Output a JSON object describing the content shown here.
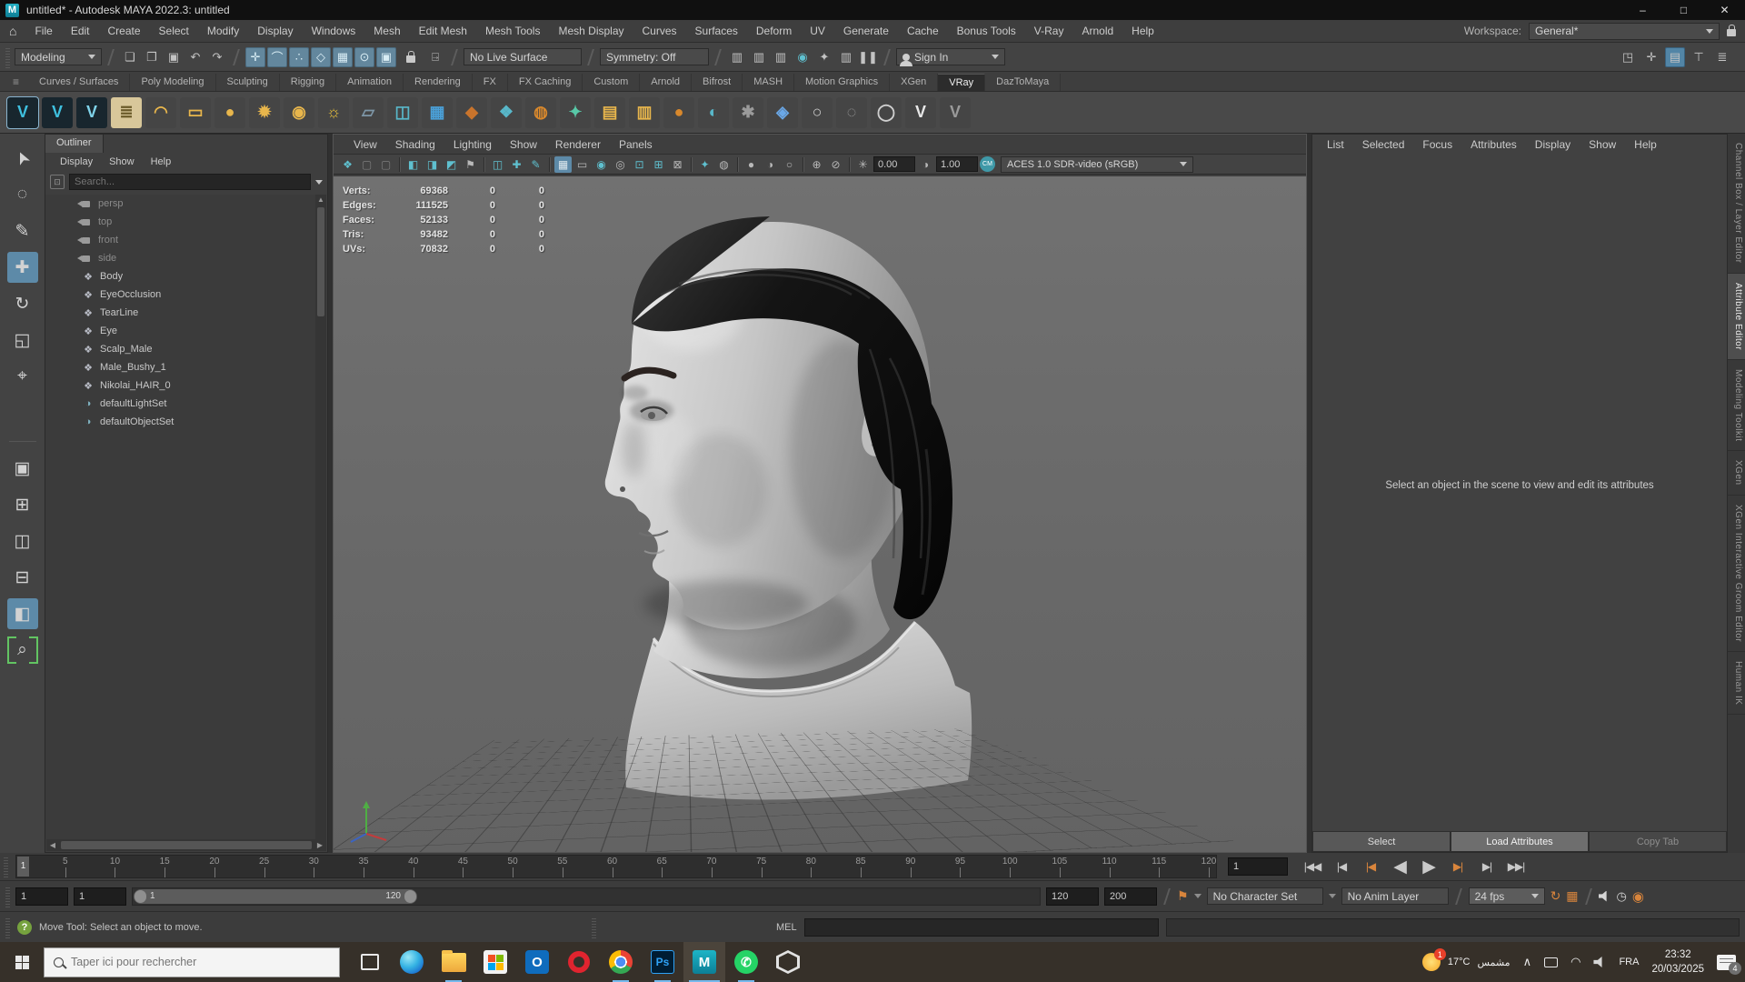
{
  "title_bar": {
    "title": "untitled* - Autodesk MAYA 2022.3: untitled",
    "minimize": "–",
    "maximize": "□",
    "close": "✕"
  },
  "menu_bar": {
    "home_icon": "⌂",
    "items": [
      "File",
      "Edit",
      "Create",
      "Select",
      "Modify",
      "Display",
      "Windows",
      "Mesh",
      "Edit Mesh",
      "Mesh Tools",
      "Mesh Display",
      "Curves",
      "Surfaces",
      "Deform",
      "UV",
      "Generate",
      "Cache",
      "Bonus Tools",
      "V-Ray",
      "Arnold",
      "Help"
    ],
    "workspace_label": "Workspace:",
    "workspace_value": "General*"
  },
  "status_line": {
    "mode": "Modeling",
    "live_surface": "No Live Surface",
    "symmetry": "Symmetry: Off",
    "sign_in": "Sign In",
    "file_icons": [
      {
        "n": "new-scene-icon",
        "g": "❏"
      },
      {
        "n": "open-scene-icon",
        "g": "❐"
      },
      {
        "n": "save-scene-icon",
        "g": "▣"
      },
      {
        "n": "undo-icon",
        "g": "↶"
      },
      {
        "n": "redo-icon",
        "g": "↷"
      }
    ],
    "snap_icons": [
      {
        "n": "snap-to-grid-icon",
        "g": "✛"
      },
      {
        "n": "snap-to-curve-icon",
        "g": "⌒"
      },
      {
        "n": "snap-to-point-icon",
        "g": "∴"
      },
      {
        "n": "snap-to-projected-center-icon",
        "g": "◇"
      },
      {
        "n": "snap-to-view-plane-icon",
        "g": "▦"
      },
      {
        "n": "make-live-icon",
        "g": "⊙"
      },
      {
        "n": "snap-together-icon",
        "g": "▣"
      }
    ],
    "render_icons": [
      {
        "n": "render-view-icon",
        "g": "▥"
      },
      {
        "n": "render-current-frame-icon",
        "g": "▥"
      },
      {
        "n": "ipr-render-icon",
        "g": "▥"
      },
      {
        "n": "light-editor-icon",
        "g": "◉",
        "c": "#5fc0cf"
      },
      {
        "n": "render-settings-icon",
        "g": "✦"
      },
      {
        "n": "hypershade-icon",
        "g": "▥"
      },
      {
        "n": "pause-viewport-icon",
        "g": "❚❚"
      }
    ],
    "right_icons": [
      {
        "n": "object-details-icon",
        "g": "◳"
      },
      {
        "n": "pose-editor-icon",
        "g": "✛"
      },
      {
        "n": "panel-layout-icon",
        "g": "▤",
        "a": 1
      },
      {
        "n": "measure-icon",
        "g": "⊤"
      },
      {
        "n": "layer-stack-icon",
        "g": "≣"
      }
    ]
  },
  "shelf": {
    "tabs": [
      {
        "label": "Curves / Surfaces"
      },
      {
        "label": "Poly Modeling"
      },
      {
        "label": "Sculpting"
      },
      {
        "label": "Rigging"
      },
      {
        "label": "Animation"
      },
      {
        "label": "Rendering"
      },
      {
        "label": "FX"
      },
      {
        "label": "FX Caching"
      },
      {
        "label": "Custom"
      },
      {
        "label": "Arnold"
      },
      {
        "label": "Bifrost"
      },
      {
        "label": "MASH"
      },
      {
        "label": "Motion Graphics"
      },
      {
        "label": "XGen"
      },
      {
        "label": "VRay",
        "active": true
      },
      {
        "label": "DazToMaya"
      }
    ],
    "icons": [
      {
        "n": "vray-render-button",
        "g": "V",
        "bg": "#18262e",
        "c": "#3fc1e0",
        "sel": true
      },
      {
        "n": "vray-vfb-button",
        "g": "V",
        "bg": "#18262e",
        "c": "#3fc1e0"
      },
      {
        "n": "vray-ipr-button",
        "g": "V",
        "bg": "#18262e",
        "c": "#7fd3ea"
      },
      {
        "n": "vray-notes-button",
        "g": "≣",
        "bg": "#d8c79a",
        "c": "#6b5b2a"
      },
      {
        "n": "vray-dome-light-button",
        "g": "◠",
        "bg": "#454545",
        "c": "#e8b64c"
      },
      {
        "n": "vray-rect-light-button",
        "g": "▭",
        "bg": "#454545",
        "c": "#e8b64c"
      },
      {
        "n": "vray-sphere-light-button",
        "g": "●",
        "bg": "#454545",
        "c": "#e8b64c"
      },
      {
        "n": "vray-ies-light-button",
        "g": "✹",
        "bg": "#454545",
        "c": "#e8b64c"
      },
      {
        "n": "vray-ambient-light-button",
        "g": "◉",
        "bg": "#454545",
        "c": "#e8b64c"
      },
      {
        "n": "vray-sun-light-button",
        "g": "☼",
        "bg": "#454545",
        "c": "#e8c03c"
      },
      {
        "n": "vray-infinite-plane-button",
        "g": "▱",
        "bg": "#454545",
        "c": "#7e97a8"
      },
      {
        "n": "vray-proxy-button",
        "g": "◫",
        "bg": "#454545",
        "c": "#58b7c9"
      },
      {
        "n": "vray-scene-button",
        "g": "▦",
        "bg": "#454545",
        "c": "#4aa0d8"
      },
      {
        "n": "vray-clipper-button",
        "g": "◆",
        "bg": "#454545",
        "c": "#c9742c"
      },
      {
        "n": "vray-mesh-light-button",
        "g": "❖",
        "bg": "#454545",
        "c": "#58b7c9"
      },
      {
        "n": "vray-toon-button",
        "g": "◍",
        "bg": "#454545",
        "c": "#d8882c"
      },
      {
        "n": "vray-fur-button",
        "g": "✦",
        "bg": "#454545",
        "c": "#58c9a8"
      },
      {
        "n": "vray-displacement-button",
        "g": "▤",
        "bg": "#454545",
        "c": "#e8b64c"
      },
      {
        "n": "vray-subdiv-button",
        "g": "▥",
        "bg": "#454545",
        "c": "#e8b64c"
      },
      {
        "n": "vray-clay-button",
        "g": "●",
        "bg": "#454545",
        "c": "#d8882c"
      },
      {
        "n": "vray-sphere-fade-button",
        "g": "◐",
        "bg": "#454545",
        "c": "#58b7c9"
      },
      {
        "n": "vray-settings-button",
        "g": "✱",
        "bg": "#454545",
        "c": "#9a9a9a"
      },
      {
        "n": "vray-denoiser-button",
        "g": "◈",
        "bg": "#454545",
        "c": "#6aa8e8"
      },
      {
        "n": "vray-sphere-button",
        "g": "○",
        "bg": "#454545",
        "c": "#cfcfcf"
      },
      {
        "n": "vray-wire-sphere-button",
        "g": "◌",
        "bg": "#454545",
        "c": "#9a9a9a"
      },
      {
        "n": "vray-circle-button",
        "g": "◯",
        "bg": "#454545",
        "c": "#cfcfcf"
      },
      {
        "n": "vray-logo-white-button",
        "g": "V",
        "bg": "#454545",
        "c": "#e8e8e8"
      },
      {
        "n": "vray-logo-gray-button",
        "g": "V",
        "bg": "#454545",
        "c": "#9a9a9a"
      }
    ]
  },
  "toolbox": {
    "tools": [
      {
        "n": "select-tool",
        "g": "➤",
        "rot": -115
      },
      {
        "n": "lasso-select-tool",
        "g": "◌"
      },
      {
        "n": "paint-select-tool",
        "g": "✎"
      },
      {
        "n": "move-tool",
        "g": "✚",
        "active": true
      },
      {
        "n": "rotate-tool",
        "g": "↻"
      },
      {
        "n": "scale-tool",
        "g": "◱"
      },
      {
        "n": "last-used-tool",
        "g": "⌖"
      }
    ],
    "layouts": [
      {
        "n": "single-pane-layout-button",
        "g": "▣"
      },
      {
        "n": "four-pane-layout-button",
        "g": "⊞"
      },
      {
        "n": "two-pane-side-layout-button",
        "g": "◫"
      },
      {
        "n": "two-pane-stack-layout-button",
        "g": "⊟"
      },
      {
        "n": "persp-outliner-layout-button",
        "g": "◧",
        "active": true
      },
      {
        "n": "zoom-select-button",
        "g": "⌕",
        "brackets": true
      }
    ]
  },
  "outliner": {
    "tab": "Outliner",
    "menus": [
      "Display",
      "Show",
      "Help"
    ],
    "search_placeholder": "Search...",
    "items": [
      {
        "label": "persp",
        "type": "camera",
        "dim": true
      },
      {
        "label": "top",
        "type": "camera",
        "dim": true
      },
      {
        "label": "front",
        "type": "camera",
        "dim": true
      },
      {
        "label": "side",
        "type": "camera",
        "dim": true
      },
      {
        "label": "Body",
        "type": "mesh"
      },
      {
        "label": "EyeOcclusion",
        "type": "mesh"
      },
      {
        "label": "TearLine",
        "type": "mesh"
      },
      {
        "label": "Eye",
        "type": "mesh"
      },
      {
        "label": "Scalp_Male",
        "type": "mesh"
      },
      {
        "label": "Male_Bushy_1",
        "type": "mesh"
      },
      {
        "label": "Nikolai_HAIR_0",
        "type": "mesh"
      },
      {
        "label": "defaultLightSet",
        "type": "set"
      },
      {
        "label": "defaultObjectSet",
        "type": "set"
      }
    ]
  },
  "viewport": {
    "menus": [
      "View",
      "Shading",
      "Lighting",
      "Show",
      "Renderer",
      "Panels"
    ],
    "toolbar_icons": [
      {
        "n": "renderer-logo-icon",
        "g": "❖",
        "c": "#5fc0cf"
      },
      {
        "n": "lookdev-icon",
        "g": "▢",
        "c": "#7d7d7d"
      },
      {
        "n": "lookdev-alt-icon",
        "g": "▢",
        "c": "#7d7d7d"
      },
      {
        "sep": 1
      },
      {
        "n": "camera-select-icon",
        "g": "◧",
        "c": "#5fc0cf"
      },
      {
        "n": "camera-lock-icon",
        "g": "◨",
        "c": "#5fc0cf"
      },
      {
        "n": "camera-attributes-icon",
        "g": "◩",
        "c": "#5fc0cf"
      },
      {
        "n": "bookmark-icon",
        "g": "⚑",
        "c": "#b8b8b8"
      },
      {
        "sep": 1
      },
      {
        "n": "image-plane-icon",
        "g": "◫",
        "c": "#5fc0cf"
      },
      {
        "n": "pan-zoom-icon",
        "g": "✚",
        "c": "#5fc0cf"
      },
      {
        "n": "grease-pencil-icon",
        "g": "✎",
        "c": "#5fc0cf"
      },
      {
        "sep": 1
      },
      {
        "n": "grid-toggle-icon",
        "g": "▦",
        "c": "#dfe9ee",
        "a": 1
      },
      {
        "n": "film-gate-icon",
        "g": "▭",
        "c": "#b8b8b8"
      },
      {
        "n": "resolution-gate-icon",
        "g": "◉",
        "c": "#5fc0cf"
      },
      {
        "n": "gate-mask-icon",
        "g": "◎",
        "c": "#b8b8b8"
      },
      {
        "n": "field-chart-icon",
        "g": "⊡",
        "c": "#5fc0cf"
      },
      {
        "n": "safe-action-icon",
        "g": "⊞",
        "c": "#5fc0cf"
      },
      {
        "n": "safe-title-icon",
        "g": "⊠",
        "c": "#b8b8b8"
      },
      {
        "sep": 1
      },
      {
        "n": "lights-icon",
        "g": "✦",
        "c": "#5fc0cf"
      },
      {
        "n": "shadows-icon",
        "g": "◍",
        "c": "#b8b8b8"
      },
      {
        "sep": 1
      },
      {
        "n": "ao-icon",
        "g": "●",
        "c": "#b8b8b8"
      },
      {
        "n": "motion-blur-icon",
        "g": "◑",
        "c": "#b8b8b8"
      },
      {
        "n": "multisample-icon",
        "g": "○",
        "c": "#b8b8b8"
      },
      {
        "sep": 1
      },
      {
        "n": "isolate-select-icon",
        "g": "⊕",
        "c": "#b8b8b8"
      },
      {
        "n": "xray-icon",
        "g": "⊘",
        "c": "#b8b8b8"
      },
      {
        "sep": 1
      }
    ],
    "exposure_icon": "✳",
    "exposure": "0.00",
    "gamma_icon": "◑",
    "gamma": "1.00",
    "cm_toggle": "CM",
    "view_transform": "ACES 1.0 SDR-video (sRGB)",
    "hud": {
      "rows": [
        {
          "label": "Verts:",
          "c1": "69368",
          "c2": "0",
          "c3": "0"
        },
        {
          "label": "Edges:",
          "c1": "111525",
          "c2": "0",
          "c3": "0"
        },
        {
          "label": "Faces:",
          "c1": "52133",
          "c2": "0",
          "c3": "0"
        },
        {
          "label": "Tris:",
          "c1": "93482",
          "c2": "0",
          "c3": "0"
        },
        {
          "label": "UVs:",
          "c1": "70832",
          "c2": "0",
          "c3": "0"
        }
      ]
    }
  },
  "attribute_editor": {
    "menus": [
      "List",
      "Selected",
      "Focus",
      "Attributes",
      "Display",
      "Show",
      "Help"
    ],
    "message": "Select an object in the scene to view and edit its attributes",
    "buttons": [
      {
        "label": "Select"
      },
      {
        "label": "Load Attributes",
        "highlight": true
      },
      {
        "label": "Copy Tab",
        "disabled": true
      }
    ]
  },
  "side_tabs": [
    {
      "label": "Channel Box / Layer Editor"
    },
    {
      "label": "Attribute Editor",
      "active": true
    },
    {
      "label": "Modeling Toolkit"
    },
    {
      "label": "XGen"
    },
    {
      "label": "XGen Interactive Groom Editor"
    },
    {
      "label": "Human IK"
    }
  ],
  "time_slider": {
    "ticks": [
      5,
      10,
      15,
      20,
      25,
      30,
      35,
      40,
      45,
      50,
      55,
      60,
      65,
      70,
      75,
      80,
      85,
      90,
      95,
      100,
      105,
      110,
      115,
      120
    ],
    "playhead": "1",
    "current_frame": "1",
    "playback": [
      {
        "n": "go-to-start-button",
        "g": "|◀◀"
      },
      {
        "n": "step-back-key-button",
        "g": "|◀"
      },
      {
        "n": "step-back-frame-button",
        "g": "|◀",
        "orange": true
      },
      {
        "n": "play-backwards-button",
        "g": "◀",
        "big": true
      },
      {
        "n": "play-forwards-button",
        "g": "▶",
        "big": true
      },
      {
        "n": "step-forward-frame-button",
        "g": "▶|",
        "orange": true
      },
      {
        "n": "step-forward-key-button",
        "g": "▶|"
      },
      {
        "n": "go-to-end-button",
        "g": "▶▶|"
      }
    ]
  },
  "range_slider": {
    "anim_start": "1",
    "play_start": "1",
    "bar_start_label": "1",
    "bar_end_label": "120",
    "play_end": "120",
    "anim_end": "200",
    "character_icon": "⚑",
    "character_set": "No Character Set",
    "anim_layer": "No Anim Layer",
    "fps": "24 fps",
    "loop_icon": "↻",
    "clip_icon": "▦",
    "sync_icon": "◷",
    "autokey_icon": "◉"
  },
  "command_line": {
    "help_icon": "?",
    "help_text": "Move Tool: Select an object to move.",
    "mel_label": "MEL"
  },
  "taskbar": {
    "search_placeholder": "Taper ici pour rechercher",
    "apps": [
      {
        "name": "task-view-icon",
        "kind": "taskview"
      },
      {
        "name": "edge-icon",
        "kind": "edge"
      },
      {
        "name": "file-explorer-icon",
        "kind": "explorer",
        "open": true
      },
      {
        "name": "microsoft-store-icon",
        "kind": "store"
      },
      {
        "name": "outlook-icon",
        "kind": "outlook",
        "g": "O"
      },
      {
        "name": "opera-icon",
        "kind": "opera"
      },
      {
        "name": "chrome-icon",
        "kind": "chrome",
        "open": true
      },
      {
        "name": "photoshop-icon",
        "kind": "photoshop",
        "g": "Ps",
        "open": true
      },
      {
        "name": "maya-icon",
        "kind": "maya",
        "g": "M",
        "open": true,
        "active": true
      },
      {
        "name": "whatsapp-icon",
        "kind": "whatsapp",
        "g": "✆",
        "open": true
      },
      {
        "name": "cube-app-icon",
        "kind": "cube"
      }
    ],
    "tray": {
      "weather_temp": "17°C",
      "weather_desc": "مشمس",
      "weather_badge": "1",
      "chevron": "∧",
      "wifi": "◠",
      "lang": "FRA",
      "time": "23:32",
      "date": "20/03/2025",
      "notification_count": "4"
    }
  }
}
